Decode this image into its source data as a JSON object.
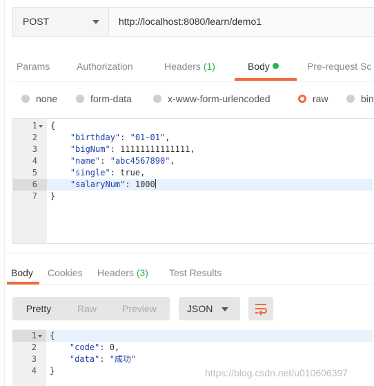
{
  "request": {
    "method": "POST",
    "url": "http://localhost:8080/learn/demo1"
  },
  "request_tabs": {
    "params": "Params",
    "authorization": "Authorization",
    "headers_label": "Headers",
    "headers_count": "(1)",
    "body": "Body",
    "prerequest": "Pre-request Sc"
  },
  "body_modes": {
    "none": "none",
    "form_data": "form-data",
    "urlencoded": "x-www-form-urlencoded",
    "raw": "raw",
    "binary": "bin",
    "selected": "raw"
  },
  "request_body": {
    "line_numbers": [
      "1",
      "2",
      "3",
      "4",
      "5",
      "6",
      "7"
    ],
    "l1": "{",
    "l2_key": "\"birthday\"",
    "l2_sep": ": ",
    "l2_val": "\"01-01\"",
    "l2_end": ",",
    "l3_key": "\"bigNum\"",
    "l3_sep": ": ",
    "l3_val": "11111111111111",
    "l3_end": ",",
    "l4_key": "\"name\"",
    "l4_sep": ": ",
    "l4_val": "\"abc4567890\"",
    "l4_end": ",",
    "l5_key": "\"single\"",
    "l5_sep": ": ",
    "l5_val": "true",
    "l5_end": ",",
    "l6_key": "\"salaryNum\"",
    "l6_sep": ": ",
    "l6_val": "1000",
    "l7": "}"
  },
  "response_tabs": {
    "body": "Body",
    "cookies": "Cookies",
    "headers_label": "Headers",
    "headers_count": "(3)",
    "test_results": "Test Results"
  },
  "response_view": {
    "pretty": "Pretty",
    "raw": "Raw",
    "preview": "Preview",
    "format": "JSON"
  },
  "response_body": {
    "line_numbers": [
      "1",
      "2",
      "3",
      "4"
    ],
    "l1": "{",
    "l2_key": "\"code\"",
    "l2_sep": ": ",
    "l2_val": "0",
    "l2_end": ",",
    "l3_key": "\"data\"",
    "l3_sep": ": ",
    "l3_val": "\"成功\"",
    "l4": "}"
  },
  "watermark": "https://blog.csdn.net/u010606397",
  "colors": {
    "accent": "#f26b3a",
    "green": "#2bb24c",
    "json_blue": "#1b3fa8"
  },
  "icons": [
    "chevron-down-icon",
    "fold-arrow-icon",
    "wrap-lines-icon"
  ]
}
